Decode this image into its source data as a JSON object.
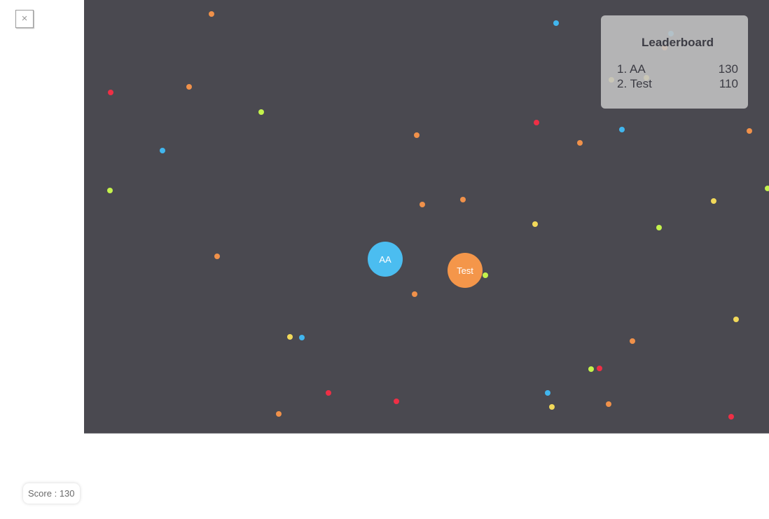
{
  "close_button": {
    "label": "×"
  },
  "leaderboard": {
    "title": "Leaderboard",
    "entries": [
      {
        "rank": "1.",
        "name": "AA",
        "score": "130"
      },
      {
        "rank": "2.",
        "name": "Test",
        "score": "110"
      }
    ]
  },
  "players": [
    {
      "name": "AA",
      "color": "#4bbdf0"
    },
    {
      "name": "Test",
      "color": "#f4964a"
    }
  ],
  "score": {
    "label": "Score",
    "separator": " : ",
    "value": "130"
  },
  "colors": {
    "arena": "#4a4950",
    "food_orange": "#f0914a",
    "food_blue": "#41b6ee",
    "food_red": "#ef2f45",
    "food_green": "#c4f24c",
    "food_yellow": "#f2d95a"
  }
}
